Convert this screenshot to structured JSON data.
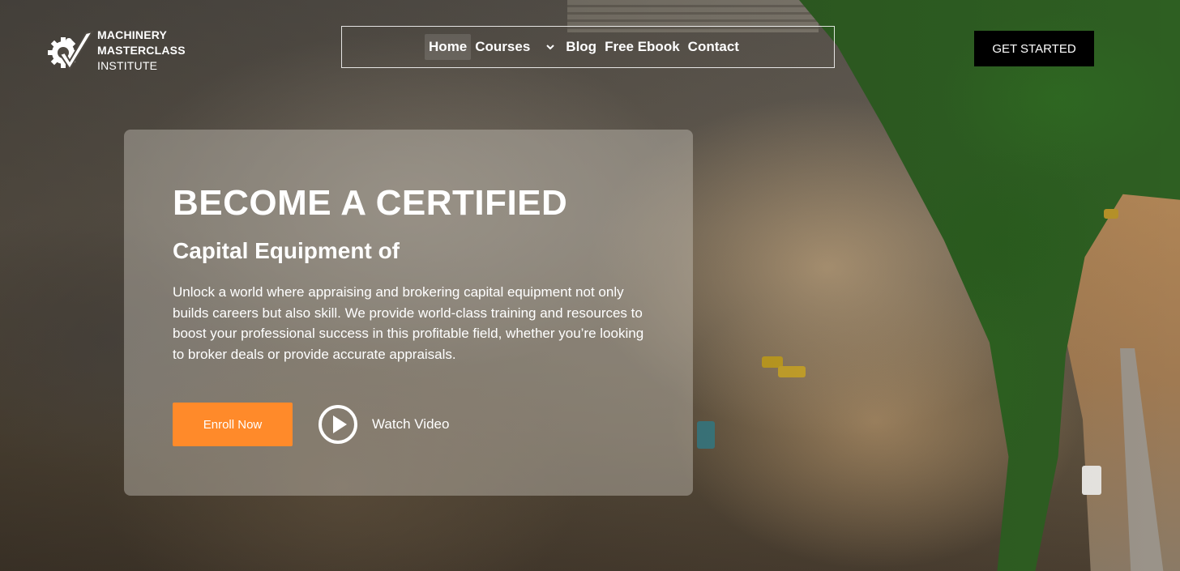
{
  "brand": {
    "line1": "MACHINERY",
    "line2": "MASTERCLASS",
    "line3": "INSTITUTE",
    "logo_icon": "gear-check-icon"
  },
  "nav": {
    "items": [
      {
        "label": "Home",
        "active": true
      },
      {
        "label": "Courses",
        "dropdown": true
      },
      {
        "label": "Blog"
      },
      {
        "label": "Free Ebook"
      },
      {
        "label": "Contact"
      }
    ]
  },
  "header": {
    "cta_label": "GET STARTED"
  },
  "hero": {
    "title": "BECOME A CERTIFIED",
    "subtitle": "Capital Equipment of",
    "body": "Unlock a world where appraising and brokering capital equipment not only builds careers but also skill. We provide world-class training and resources to boost your professional success in this profitable field, whether you’re looking to broker deals or provide accurate appraisals.",
    "primary_button": "Enroll Now",
    "video_label": "Watch Video",
    "video_icon": "play-circle-icon"
  },
  "colors": {
    "accent": "#ff8a2a",
    "cta_dark": "#000000"
  }
}
